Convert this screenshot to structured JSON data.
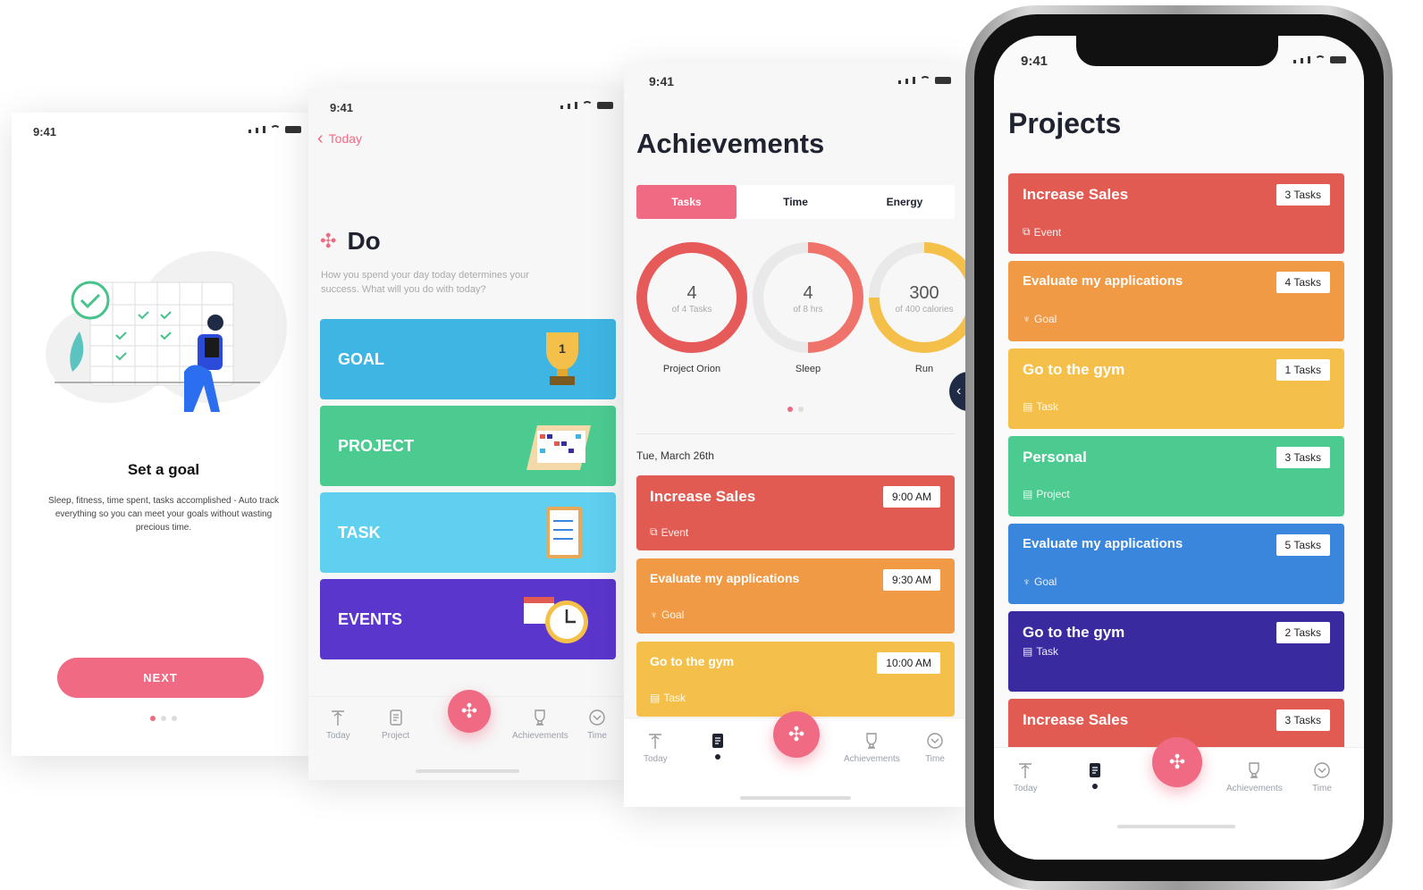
{
  "onboarding": {
    "status_time": "9:41",
    "title": "Set a goal",
    "description": "Sleep, fitness, time spent, tasks accomplished - Auto track everything so you can meet your goals without wasting precious time.",
    "next_button": "NEXT"
  },
  "do_screen": {
    "status_time": "9:41",
    "back_label": "Today",
    "title": "Do",
    "subtitle": "How you spend your day today determines your success. What will you do with today?",
    "cards": [
      {
        "label": "GOAL",
        "color": "#3fb5e3"
      },
      {
        "label": "PROJECT",
        "color": "#4ccb91"
      },
      {
        "label": "TASK",
        "color": "#5fd0ef"
      },
      {
        "label": "EVENTS",
        "color": "#5b36cc"
      }
    ],
    "tabs": [
      "Today",
      "Project",
      "Achievements",
      "Time"
    ]
  },
  "achievements": {
    "status_time": "9:41",
    "title": "Achievements",
    "segments": [
      "Tasks",
      "Time",
      "Energy"
    ],
    "rings": [
      {
        "value": "4",
        "sub": "of 4 Tasks",
        "label": "Project Orion",
        "color": "#e65a5a",
        "fraction": 1.0
      },
      {
        "value": "4",
        "sub": "of 8 hrs",
        "label": "Sleep",
        "color": "#f0736b",
        "fraction": 0.5
      },
      {
        "value": "300",
        "sub": "of 400 calories",
        "label": "Run",
        "color": "#f5c04a",
        "fraction": 0.75
      }
    ],
    "date": "Tue, March 26th",
    "events": [
      {
        "title": "Increase Sales",
        "time": "9:00 AM",
        "type": "Event",
        "color": "#e25b52"
      },
      {
        "title": "Evaluate my applications",
        "time": "9:30 AM",
        "type": "Goal",
        "color": "#f19a46"
      },
      {
        "title": "Go to the gym",
        "time": "10:00 AM",
        "type": "Task",
        "color": "#f5c04a"
      }
    ],
    "tabs": [
      "Today",
      "Achievements",
      "Time"
    ]
  },
  "projects": {
    "status_time": "9:41",
    "title": "Projects",
    "items": [
      {
        "title": "Increase Sales",
        "tasks": "3 Tasks",
        "type": "Event",
        "color": "#e25b52"
      },
      {
        "title": "Evaluate my applications",
        "tasks": "4 Tasks",
        "type": "Goal",
        "color": "#f19a46"
      },
      {
        "title": "Go to the gym",
        "tasks": "1 Tasks",
        "type": "Task",
        "color": "#f5c04a"
      },
      {
        "title": "Personal",
        "tasks": "3 Tasks",
        "type": "Project",
        "color": "#4ccb91"
      },
      {
        "title": "Evaluate my applications",
        "tasks": "5 Tasks",
        "type": "Goal",
        "color": "#3a86dc"
      },
      {
        "title": "Go to the gym",
        "tasks": "2 Tasks",
        "type": "Task",
        "color": "#3a2aa0"
      },
      {
        "title": "Increase Sales",
        "tasks": "3 Tasks",
        "type": "",
        "color": "#e25b52"
      }
    ],
    "tabs": [
      "Today",
      "Achievements",
      "Time"
    ]
  }
}
